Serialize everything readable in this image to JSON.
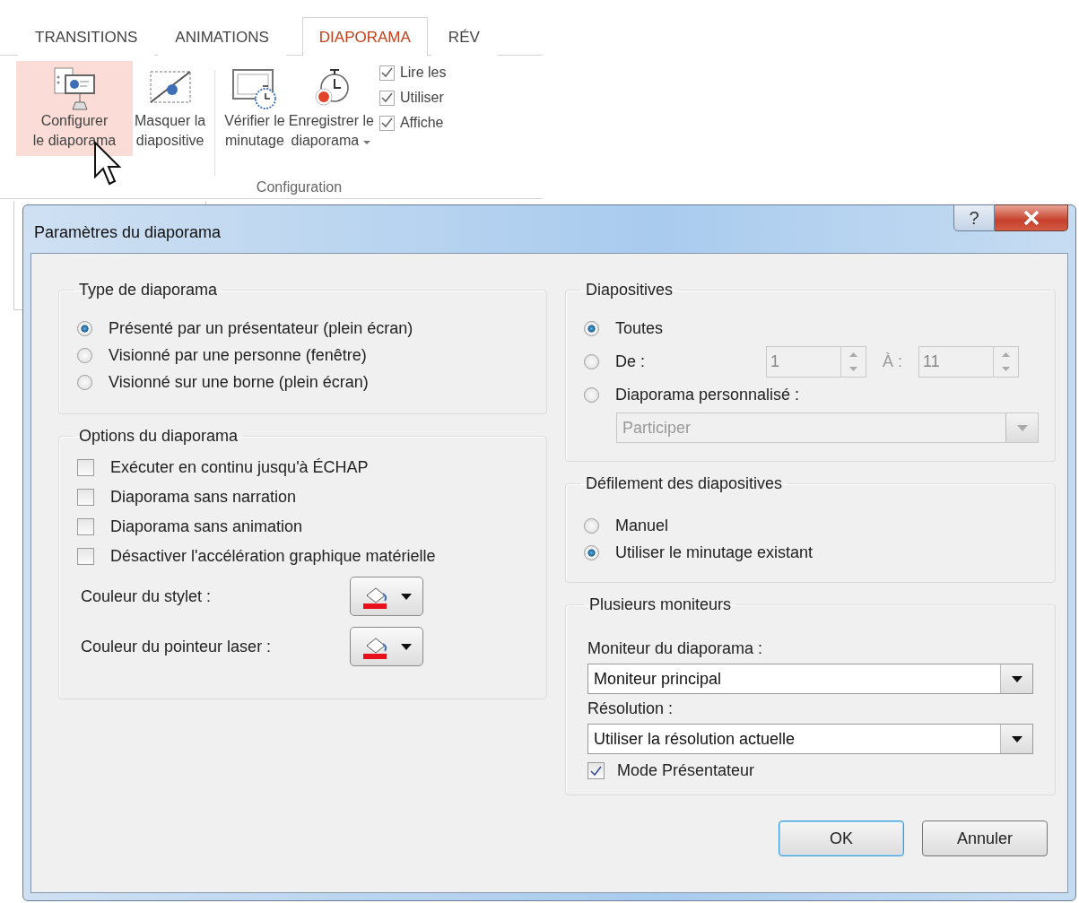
{
  "ribbon": {
    "tabs": [
      {
        "label": "TRANSITIONS",
        "selected": false
      },
      {
        "label": "ANIMATIONS",
        "selected": false
      },
      {
        "label": "DIAPORAMA",
        "selected": true
      },
      {
        "label": "RÉV",
        "selected": false
      }
    ],
    "buttons": [
      {
        "kind": "configure",
        "lines": [
          "Configurer",
          "le diaporama"
        ],
        "highlighted": true,
        "dropdown": false
      },
      {
        "kind": "hide",
        "lines": [
          "Masquer la",
          "diapositive"
        ],
        "highlighted": false,
        "dropdown": false
      },
      {
        "kind": "timing",
        "lines": [
          "Vérifier le",
          "minutage"
        ],
        "highlighted": false,
        "dropdown": false
      },
      {
        "kind": "record",
        "lines": [
          "Enregistrer le",
          "diaporama"
        ],
        "highlighted": false,
        "dropdown": true
      }
    ],
    "checkboxes": [
      {
        "label": "Lire les",
        "checked": true
      },
      {
        "label": "Utiliser",
        "checked": true
      },
      {
        "label": "Affiche",
        "checked": true
      }
    ],
    "group_label": "Configuration"
  },
  "dialog": {
    "title": "Paramètres du diaporama",
    "help": "?",
    "type_group": {
      "title": "Type de diaporama",
      "options": [
        {
          "label": "Présenté par un présentateur (plein écran)",
          "selected": true
        },
        {
          "label": "Visionné par une personne (fenêtre)",
          "selected": false
        },
        {
          "label": "Visionné sur une borne (plein écran)",
          "selected": false
        }
      ]
    },
    "options_group": {
      "title": "Options du diaporama",
      "checkboxes": [
        {
          "label": "Exécuter en continu jusqu'à ÉCHAP",
          "checked": false
        },
        {
          "label": "Diaporama sans narration",
          "checked": false
        },
        {
          "label": "Diaporama sans animation",
          "checked": false
        },
        {
          "label": "Désactiver l'accélération graphique matérielle",
          "checked": false
        }
      ],
      "color_pickers": [
        {
          "label": "Couleur du stylet :",
          "color": "#e8101a"
        },
        {
          "label": "Couleur du pointeur laser :",
          "color": "#e8101a"
        }
      ]
    },
    "slides_group": {
      "title": "Diapositives",
      "options": [
        {
          "kind": "all",
          "label": "Toutes",
          "selected": true
        },
        {
          "kind": "range",
          "label": "De :",
          "selected": false,
          "from": "1",
          "to_label": "À :",
          "to": "11"
        },
        {
          "kind": "custom",
          "label": "Diaporama personnalisé :",
          "selected": false,
          "value": "Participer"
        }
      ]
    },
    "advance_group": {
      "title": "Défilement des diapositives",
      "options": [
        {
          "label": "Manuel",
          "selected": false
        },
        {
          "label": "Utiliser le minutage existant",
          "selected": true
        }
      ]
    },
    "monitors_group": {
      "title": "Plusieurs moniteurs",
      "monitor_label": "Moniteur du diaporama :",
      "monitor_value": "Moniteur principal",
      "resolution_label": "Résolution :",
      "resolution_value": "Utiliser la résolution actuelle",
      "presenter": {
        "label": "Mode Présentateur",
        "checked": true
      }
    },
    "buttons": [
      {
        "label": "OK",
        "default": true
      },
      {
        "label": "Annuler",
        "default": false
      }
    ]
  }
}
